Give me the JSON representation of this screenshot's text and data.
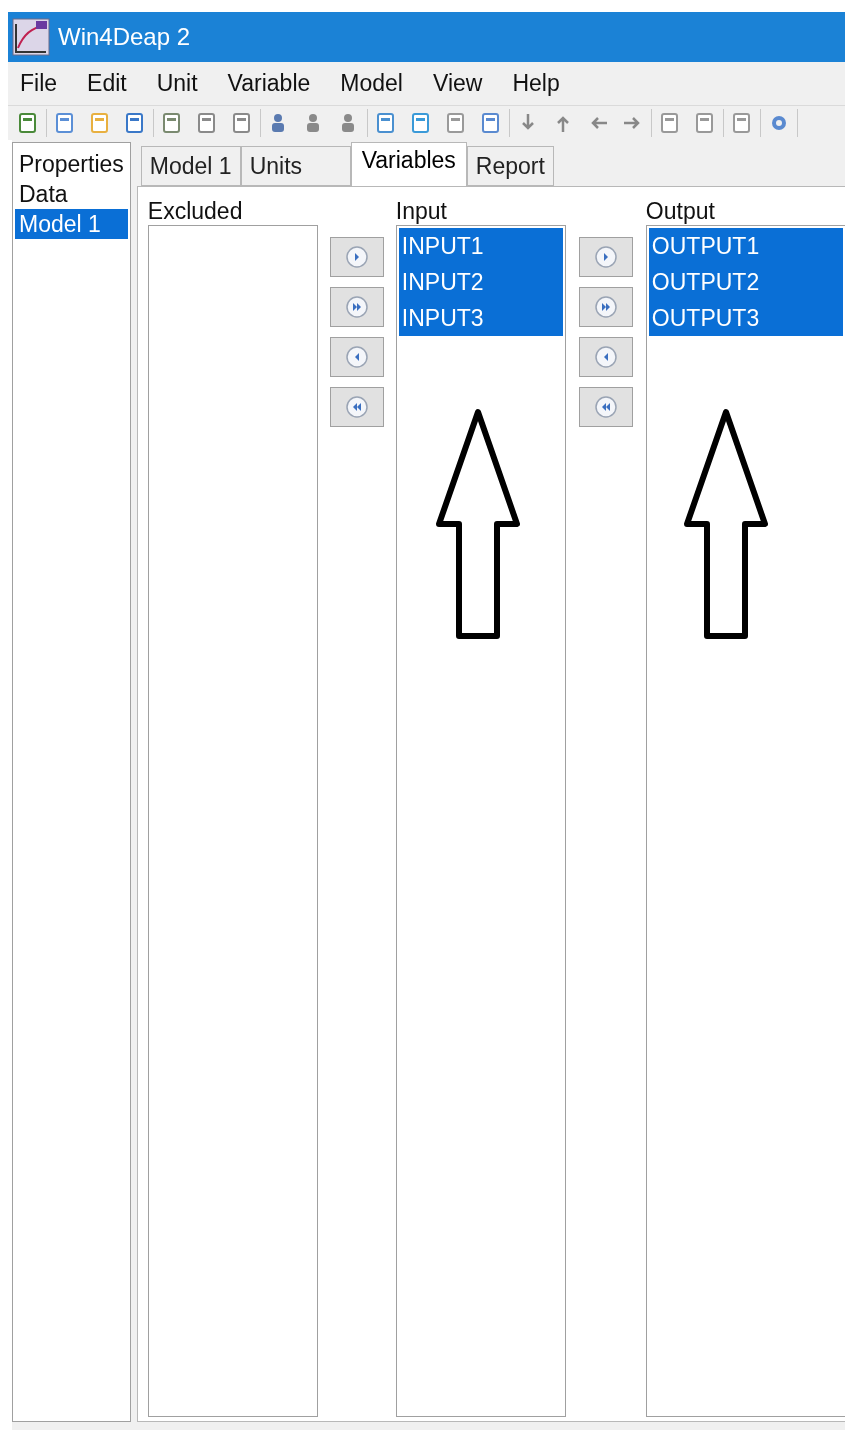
{
  "window": {
    "title": "Win4Deap 2"
  },
  "menu": [
    "File",
    "Edit",
    "Unit",
    "Variable",
    "Model",
    "View",
    "Help"
  ],
  "sidebar": {
    "items": [
      {
        "label": "Properties",
        "selected": false
      },
      {
        "label": "Data",
        "selected": false
      },
      {
        "label": "Model 1",
        "selected": true
      }
    ]
  },
  "tabs": [
    {
      "label": "Model 1",
      "selected": false
    },
    {
      "label": "Units",
      "selected": false
    },
    {
      "label": "Variables",
      "selected": true
    },
    {
      "label": "Report",
      "selected": false
    }
  ],
  "lists": [
    {
      "label": "Excluded"
    },
    {
      "label": "Input",
      "items": [
        {
          "text": "INPUT1",
          "selected": true
        },
        {
          "text": "INPUT2",
          "selected": true
        },
        {
          "text": "INPUT3",
          "selected": true
        }
      ]
    },
    {
      "label": "Output",
      "items": [
        {
          "text": "OUTPUT1",
          "selected": true
        },
        {
          "text": "OUTPUT2",
          "selected": true
        },
        {
          "text": "OUTPUT3",
          "selected": true
        }
      ]
    }
  ]
}
